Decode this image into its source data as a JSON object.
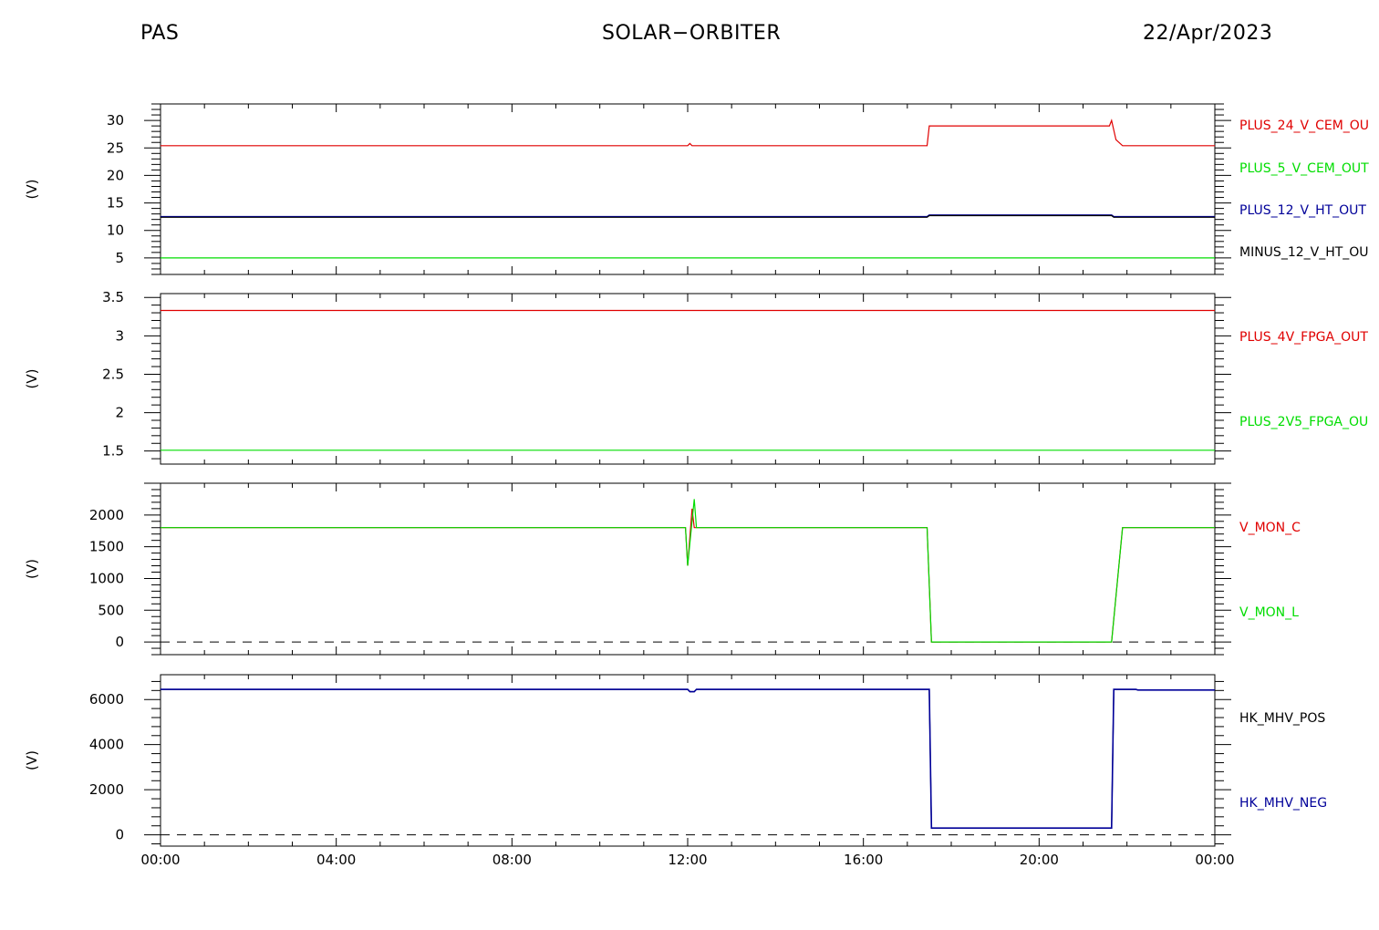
{
  "header": {
    "left": "PAS",
    "center": "SOLAR−ORBITER",
    "right": "22/Apr/2023"
  },
  "colors": {
    "red": "#e00000",
    "green": "#00dd00",
    "blue": "#000099",
    "black": "#000000"
  },
  "x_tick_labels": [
    "00:00",
    "04:00",
    "08:00",
    "12:00",
    "16:00",
    "20:00",
    "00:00"
  ],
  "chart_data": [
    {
      "type": "line",
      "ylabel": "(V)",
      "ylim": [
        2,
        33
      ],
      "yticks": [
        5,
        10,
        15,
        20,
        25,
        30
      ],
      "zero_line": false,
      "series": [
        {
          "name": "PLUS_24_V_CEM_OU",
          "color": "red",
          "x": [
            0,
            12.0,
            12.05,
            12.1,
            12.2,
            17.45,
            17.5,
            21.6,
            21.65,
            21.75,
            21.9,
            24
          ],
          "y": [
            25.4,
            25.4,
            25.8,
            25.4,
            25.4,
            25.4,
            29.0,
            29.0,
            30.0,
            26.5,
            25.4,
            25.4
          ]
        },
        {
          "name": "PLUS_5_V_CEM_OUT",
          "color": "green",
          "x": [
            0,
            24
          ],
          "y": [
            5.0,
            5.0
          ]
        },
        {
          "name": "PLUS_12_V_HT_OUT",
          "color": "blue",
          "x": [
            0,
            17.45,
            17.5,
            21.65,
            21.7,
            24
          ],
          "y": [
            12.5,
            12.5,
            12.8,
            12.8,
            12.5,
            12.5
          ]
        },
        {
          "name": "MINUS_12_V_HT_OU",
          "color": "black",
          "x": [
            0,
            17.45,
            17.5,
            21.65,
            21.7,
            24
          ],
          "y": [
            12.4,
            12.4,
            12.7,
            12.7,
            12.4,
            12.4
          ]
        }
      ]
    },
    {
      "type": "line",
      "ylabel": "(V)",
      "ylim": [
        1.33,
        3.55
      ],
      "yticks": [
        1.5,
        2.0,
        2.5,
        3.0,
        3.5
      ],
      "zero_line": false,
      "series": [
        {
          "name": "PLUS_4V_FPGA_OUT",
          "color": "red",
          "x": [
            0,
            24
          ],
          "y": [
            3.33,
            3.33
          ]
        },
        {
          "name": "PLUS_2V5_FPGA_OU",
          "color": "green",
          "x": [
            0,
            24
          ],
          "y": [
            1.51,
            1.51
          ]
        }
      ]
    },
    {
      "type": "line",
      "ylabel": "(V)",
      "ylim": [
        -200,
        2500
      ],
      "yticks": [
        0,
        500,
        1000,
        1500,
        2000
      ],
      "zero_line": true,
      "series": [
        {
          "name": "V_MON_C",
          "color": "red",
          "x": [
            0,
            11.95,
            12.0,
            12.1,
            12.15,
            12.2,
            17.45,
            17.55,
            21.65,
            21.9,
            24
          ],
          "y": [
            1800,
            1800,
            1200,
            2100,
            1800,
            1800,
            1800,
            0,
            0,
            1800,
            1800
          ]
        },
        {
          "name": "V_MON_L",
          "color": "green",
          "x": [
            0,
            11.95,
            12.0,
            12.15,
            12.2,
            17.45,
            17.55,
            21.65,
            21.9,
            24
          ],
          "y": [
            1800,
            1800,
            1200,
            2250,
            1800,
            1800,
            0,
            0,
            1800,
            1800
          ]
        }
      ]
    },
    {
      "type": "line",
      "ylabel": "(V)",
      "ylim": [
        -500,
        7100
      ],
      "yticks": [
        0,
        2000,
        4000,
        6000
      ],
      "zero_line": true,
      "series": [
        {
          "name": "HK_MHV_POS",
          "color": "black",
          "x": [
            0,
            12.0,
            12.05,
            12.15,
            12.2,
            17.5,
            17.55,
            21.65,
            21.7,
            22.2,
            22.25,
            24
          ],
          "y": [
            6450,
            6450,
            6350,
            6350,
            6450,
            6450,
            300,
            300,
            6450,
            6450,
            6420,
            6420
          ]
        },
        {
          "name": "HK_MHV_NEG",
          "color": "blue",
          "x": [
            0,
            12.0,
            12.05,
            12.15,
            12.2,
            17.5,
            17.55,
            21.65,
            21.7,
            22.2,
            22.25,
            24
          ],
          "y": [
            6450,
            6450,
            6350,
            6350,
            6450,
            6450,
            300,
            300,
            6450,
            6450,
            6420,
            6420
          ]
        }
      ]
    }
  ]
}
